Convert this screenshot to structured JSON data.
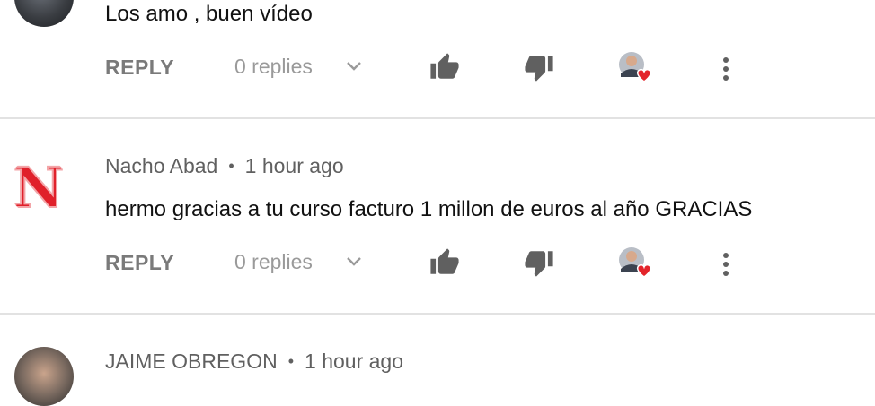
{
  "comments": [
    {
      "author": "",
      "time": "",
      "text": "Los amo , buen vídeo",
      "reply_label": "REPLY",
      "replies_label": "0 replies"
    },
    {
      "author": "Nacho Abad",
      "time": "1 hour ago",
      "text": "hermo gracias a tu curso facturo 1 millon de euros al año GRACIAS",
      "reply_label": "REPLY",
      "replies_label": "0 replies",
      "avatar_letter": "N"
    },
    {
      "author": "JAIME OBREGON",
      "time": "1 hour ago"
    }
  ],
  "colors": {
    "action_text": "#7a7a7a",
    "icon_gray": "#606060",
    "heart_red": "#e3242b",
    "avatar_letter_red": "#e0202a",
    "divider": "#e2e2e2"
  },
  "icons": [
    "thumbs-up-icon",
    "thumbs-down-icon",
    "creator-heart-icon",
    "more-vert-icon",
    "chevron-down-icon"
  ]
}
